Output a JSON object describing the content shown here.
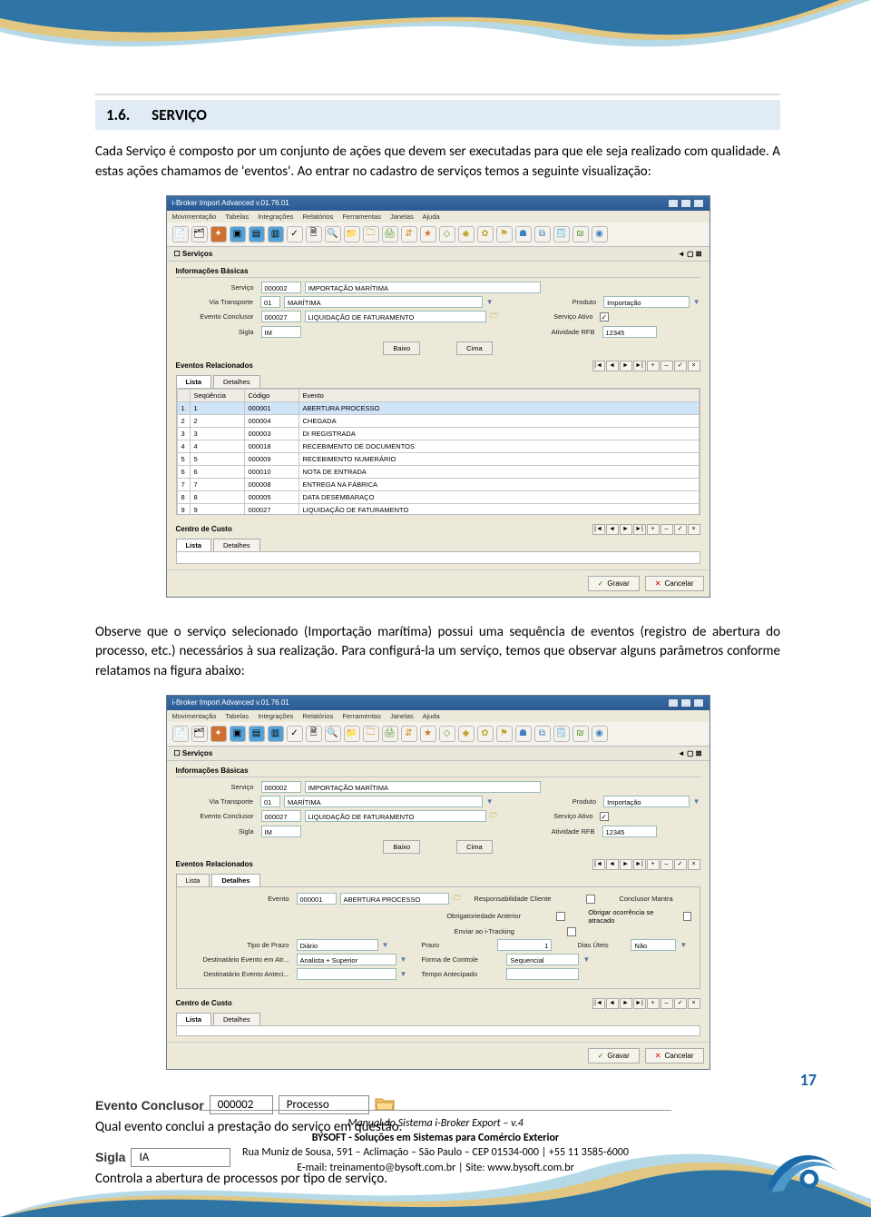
{
  "section": {
    "number": "1.6.",
    "title": "SERVIÇO"
  },
  "para1": "Cada Serviço é composto por um conjunto de ações que devem ser executadas para que ele seja realizado com qualidade.  A estas ações chamamos de 'eventos'. Ao entrar no cadastro de serviços temos a seguinte visualização:",
  "para2": "Observe  que  o  serviço  selecionado  (Importação  marítima)  possui  uma  sequência  de  eventos  (registro de abertura do processo, etc.) necessários à sua realização. Para configurá-la um serviço,  temos que observar alguns parâmetros conforme relatamos na figura abaixo:",
  "app": {
    "title": "i-Broker Import Advanced v.01.76.01",
    "menu": [
      "Movimentação",
      "Tabelas",
      "Integrações",
      "Relatórios",
      "Ferramentas",
      "Janelas",
      "Ajuda"
    ],
    "subheader": "Serviços",
    "panel_heading": "Informações Básicas",
    "labels": {
      "servico": "Serviço",
      "via": "Via Transporte",
      "evento_conc": "Evento Conclusor",
      "sigla": "Sigla",
      "produto": "Produto",
      "ativo": "Serviço Ativo",
      "atividade": "Atividade RFB",
      "baixo": "Baixo",
      "cima": "Cima",
      "eventos_rel": "Eventos Relacionados",
      "centro": "Centro de Custo"
    },
    "fields": {
      "servico_code": "000002",
      "servico_desc": "IMPORTAÇÃO MARÍTIMA",
      "via_code": "01",
      "via_desc": "MARÍTIMA",
      "evento_conc_code": "000027",
      "evento_conc_desc": "LIQUIDAÇÃO DE FATURAMENTO",
      "sigla_val": "IM",
      "produto_val": "Importação",
      "atividade_val": "12345"
    },
    "tabs": [
      "Lista",
      "Detalhes"
    ],
    "grid_headers": {
      "seq": "Seqüência",
      "codigo": "Código",
      "evento": "Evento"
    },
    "grid_rows": [
      {
        "n": "1",
        "seq": "1",
        "cod": "000001",
        "ev": "ABERTURA PROCESSO"
      },
      {
        "n": "2",
        "seq": "2",
        "cod": "000004",
        "ev": "CHEGADA"
      },
      {
        "n": "3",
        "seq": "3",
        "cod": "000003",
        "ev": "DI REGISTRADA"
      },
      {
        "n": "4",
        "seq": "4",
        "cod": "000018",
        "ev": "RECEBIMENTO DE DOCUMENTOS"
      },
      {
        "n": "5",
        "seq": "5",
        "cod": "000009",
        "ev": "RECEBIMENTO NUMERÁRIO"
      },
      {
        "n": "6",
        "seq": "6",
        "cod": "000010",
        "ev": "NOTA DE ENTRADA"
      },
      {
        "n": "7",
        "seq": "7",
        "cod": "000008",
        "ev": "ENTREGA NA FÁBRICA"
      },
      {
        "n": "8",
        "seq": "8",
        "cod": "000005",
        "ev": "DATA DESEMBARAÇO"
      },
      {
        "n": "9",
        "seq": "9",
        "cod": "000027",
        "ev": "LIQUIDAÇÃO DE FATURAMENTO"
      }
    ],
    "buttons": {
      "gravar": "Gravar",
      "cancelar": "Cancelar"
    },
    "details": {
      "evento_lbl": "Evento",
      "evento_code": "000001",
      "evento_desc": "ABERTURA PROCESSO",
      "tipo_prazo_lbl": "Tipo de Prazo",
      "tipo_prazo_val": "Diário",
      "dest_atr_lbl": "Destinatário Evento em Atr...",
      "dest_atr_val": "Analista + Superior",
      "dest_ant_lbl": "Destinatário Evento Anteci...",
      "resp_cli_lbl": "Responsabilidade Cliente",
      "obrig_ant_lbl": "Obrigatoriedade Anterior",
      "enviar_lbl": "Enviar ao i-Tracking",
      "prazo_lbl": "Prazo",
      "prazo_val": "1",
      "forma_lbl": "Forma de Controle",
      "forma_val": "Sequencial",
      "tempo_lbl": "Tempo Antecipado",
      "conc_mantra_lbl": "Conclusor Mantra",
      "obrig_atr_lbl": "Obrigar ocorrência se atracado",
      "dias_lbl": "Dias Úteis",
      "dias_val": "Não"
    }
  },
  "example1": {
    "label": "Evento Conclusor",
    "code": "000002",
    "desc": "Processo"
  },
  "caption1": "Qual evento conclui a prestação do serviço em questão.",
  "example2": {
    "label": "Sigla",
    "value": "IA"
  },
  "caption2": "Controla a abertura de processos por tipo de serviço.",
  "page_number": "17",
  "footer": {
    "line1": "Manual do Sistema i-Broker Export – v.4",
    "line2": "BYSOFT - Soluções em Sistemas para Comércio Exterior",
    "line3": "Rua Muniz de Sousa, 591 – Aclimação – São Paulo – CEP 01534-000 | +55 11 3585-6000",
    "line4": "E-mail: treinamento@bysoft.com.br | Site: www.bysoft.com.br"
  }
}
